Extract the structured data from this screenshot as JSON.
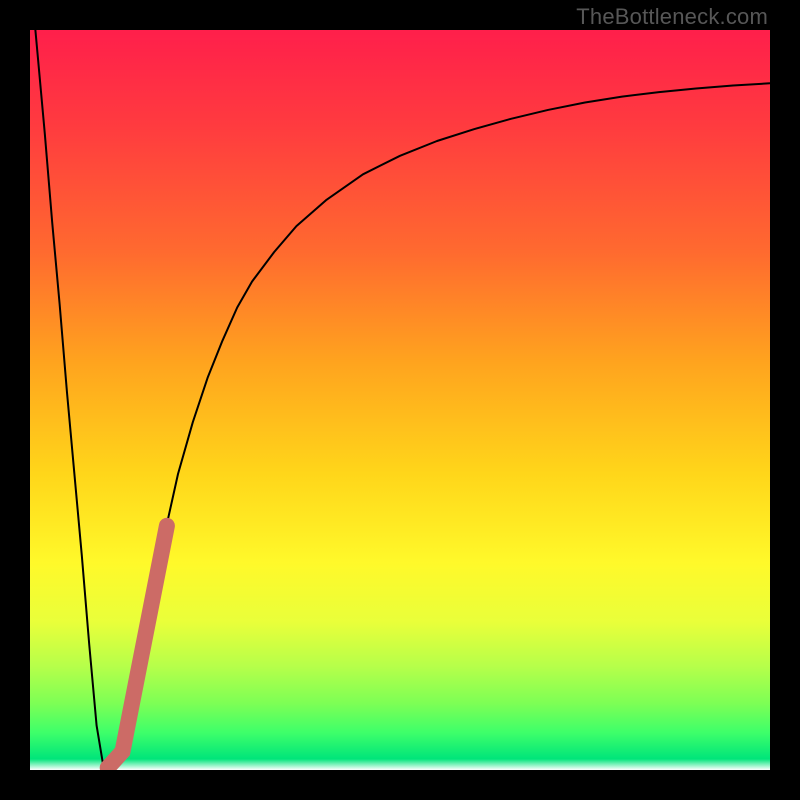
{
  "watermark": "TheBottleneck.com",
  "chart_data": {
    "type": "line",
    "title": "",
    "xlabel": "",
    "ylabel": "",
    "xlim": [
      0,
      100
    ],
    "ylim": [
      0,
      100
    ],
    "gradient_stops": [
      {
        "offset": 0.0,
        "color": "#ff1f4b"
      },
      {
        "offset": 0.13,
        "color": "#ff3b3f"
      },
      {
        "offset": 0.3,
        "color": "#ff6a2f"
      },
      {
        "offset": 0.45,
        "color": "#ffa41e"
      },
      {
        "offset": 0.6,
        "color": "#ffd61a"
      },
      {
        "offset": 0.72,
        "color": "#fff92a"
      },
      {
        "offset": 0.8,
        "color": "#e9ff3a"
      },
      {
        "offset": 0.86,
        "color": "#b6ff4a"
      },
      {
        "offset": 0.91,
        "color": "#7dff55"
      },
      {
        "offset": 0.95,
        "color": "#3dff6a"
      },
      {
        "offset": 0.985,
        "color": "#00e57a"
      },
      {
        "offset": 1.0,
        "color": "#ffffff"
      }
    ],
    "series": [
      {
        "name": "bottleneck-curve",
        "color": "#000000",
        "width": 2.0,
        "x": [
          0,
          1,
          2,
          3,
          4,
          5,
          6,
          7,
          8,
          9,
          10,
          11,
          12,
          13,
          14,
          16,
          18,
          20,
          22,
          24,
          26,
          28,
          30,
          33,
          36,
          40,
          45,
          50,
          55,
          60,
          65,
          70,
          75,
          80,
          85,
          90,
          95,
          100
        ],
        "y": [
          108,
          97,
          86,
          74,
          63,
          51,
          40,
          29,
          17,
          6,
          0,
          0.2,
          1.5,
          5,
          10,
          21,
          31,
          40,
          47,
          53,
          58,
          62.5,
          66,
          70,
          73.5,
          77,
          80.5,
          83,
          85,
          86.6,
          88,
          89.2,
          90.2,
          91,
          91.6,
          92.1,
          92.5,
          92.8
        ]
      },
      {
        "name": "highlight-segment",
        "color": "#cc6b66",
        "width": 16,
        "linecap": "round",
        "x": [
          10.5,
          12.5,
          18.5
        ],
        "y": [
          0.3,
          2.5,
          33
        ]
      }
    ]
  }
}
